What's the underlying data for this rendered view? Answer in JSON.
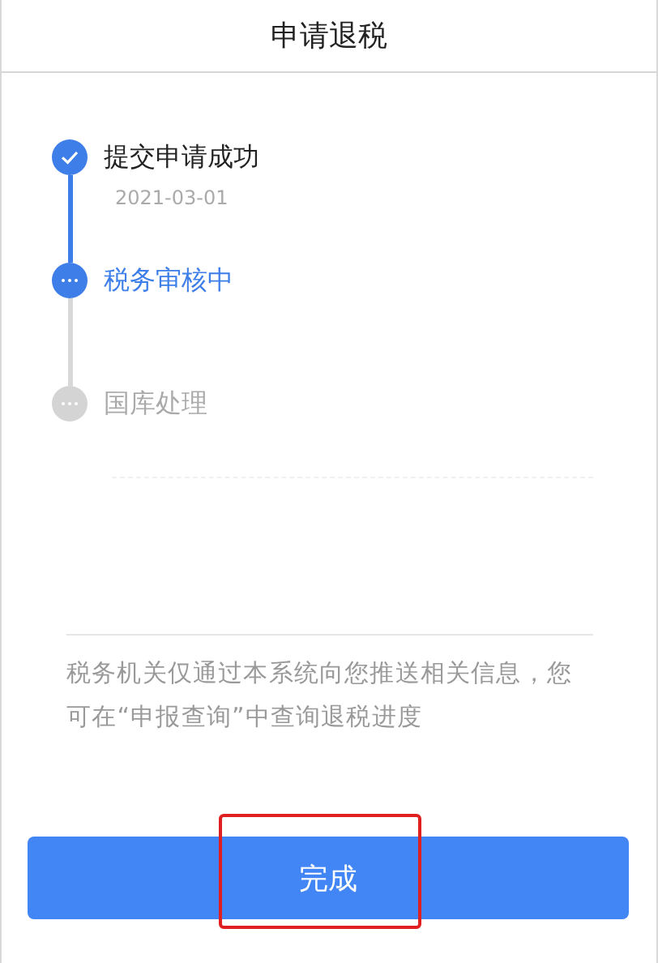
{
  "header": {
    "title": "申请退税"
  },
  "steps": [
    {
      "title": "提交申请成功",
      "date": "2021-03-01",
      "kind": "done"
    },
    {
      "title": "税务审核中",
      "kind": "current"
    },
    {
      "title": "国库处理",
      "kind": "pending"
    }
  ],
  "notice": "税务机关仅通过本系统向您推送相关信息，您可在“申报查询”中查询退税进度",
  "button": {
    "label": "完成",
    "highlighted": true
  }
}
